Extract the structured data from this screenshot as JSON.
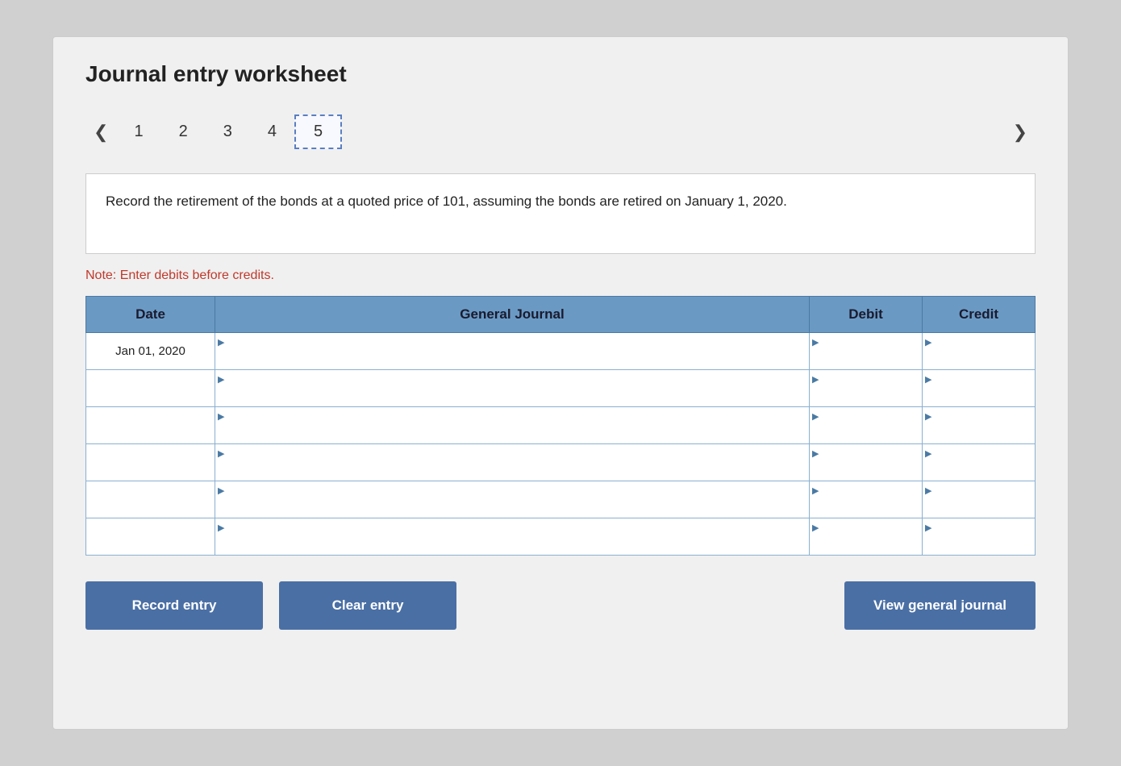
{
  "title": "Journal entry worksheet",
  "navigation": {
    "prev_arrow": "❮",
    "next_arrow": "❯",
    "tabs": [
      {
        "label": "1",
        "active": false
      },
      {
        "label": "2",
        "active": false
      },
      {
        "label": "3",
        "active": false
      },
      {
        "label": "4",
        "active": false
      },
      {
        "label": "5",
        "active": true
      }
    ]
  },
  "instruction": "Record the retirement of the bonds at a quoted price of 101, assuming the bonds are retired on January 1, 2020.",
  "note": "Note: Enter debits before credits.",
  "table": {
    "headers": [
      "Date",
      "General Journal",
      "Debit",
      "Credit"
    ],
    "rows": [
      {
        "date": "Jan 01, 2020",
        "journal": "",
        "debit": "",
        "credit": ""
      },
      {
        "date": "",
        "journal": "",
        "debit": "",
        "credit": ""
      },
      {
        "date": "",
        "journal": "",
        "debit": "",
        "credit": ""
      },
      {
        "date": "",
        "journal": "",
        "debit": "",
        "credit": ""
      },
      {
        "date": "",
        "journal": "",
        "debit": "",
        "credit": ""
      },
      {
        "date": "",
        "journal": "",
        "debit": "",
        "credit": ""
      }
    ]
  },
  "buttons": {
    "record_entry": "Record entry",
    "clear_entry": "Clear entry",
    "view_general_journal": "View general journal"
  }
}
